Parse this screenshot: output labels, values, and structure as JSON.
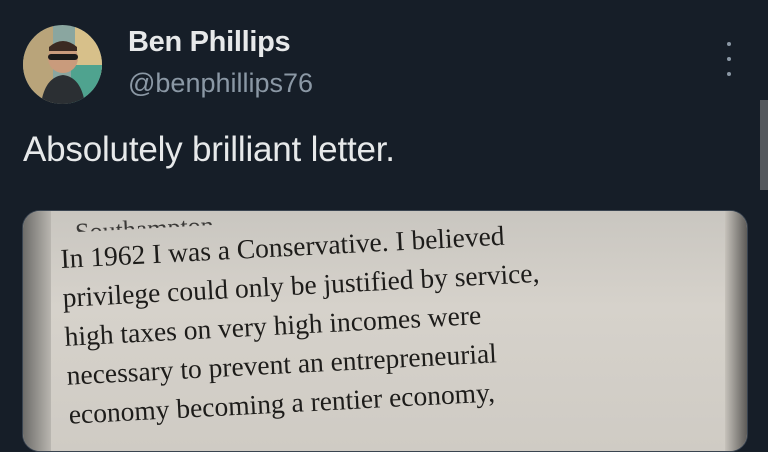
{
  "post": {
    "author": {
      "display_name": "Ben Phillips",
      "handle": "@benphillips76",
      "avatar_icon": "user-avatar-photo"
    },
    "more_icon": "more-vertical-icon",
    "text": "Absolutely brilliant letter."
  },
  "media": {
    "heading_fragment": "Southampton",
    "lines": [
      "In 1962 I was a Conservative. I believed",
      "privilege could only be justified by service,",
      "high taxes on very high incomes were",
      "necessary to prevent an entrepreneurial",
      "economy becoming a rentier economy,"
    ]
  },
  "colors": {
    "background": "#161e28",
    "primary_text": "#e7e9ea",
    "secondary_text": "#8b98a5",
    "paper": "#d3cfc8"
  }
}
